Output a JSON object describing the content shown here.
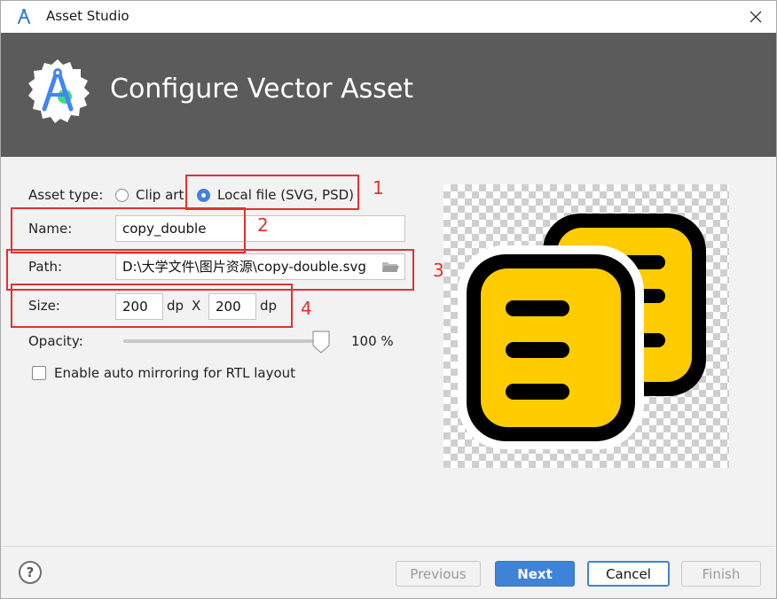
{
  "window": {
    "title": "Asset Studio"
  },
  "header": {
    "title": "Configure Vector Asset"
  },
  "form": {
    "asset_type_label": "Asset type:",
    "asset_type_options": [
      {
        "label": "Clip art",
        "selected": false
      },
      {
        "label": "Local file (SVG, PSD)",
        "selected": true
      }
    ],
    "name_label": "Name:",
    "name_value": "copy_double",
    "path_label": "Path:",
    "path_value": "D:\\大学文件\\图片资源\\copy-double.svg",
    "size_label": "Size:",
    "size_width": "200",
    "size_height": "200",
    "size_unit": "dp",
    "size_separator": "X",
    "opacity_label": "Opacity:",
    "opacity_value": "100 %",
    "opacity_level": 1.0,
    "rtl_label": "Enable auto mirroring for RTL layout",
    "rtl_checked": false
  },
  "annotations": [
    "1",
    "2",
    "3",
    "4"
  ],
  "footer": {
    "help": "?",
    "previous": "Previous",
    "next": "Next",
    "cancel": "Cancel",
    "finish": "Finish"
  },
  "colors": {
    "accent": "#3f83d6",
    "header_bg": "#5b5b5b",
    "annotation": "#e53030",
    "icon_fill": "#ffcc00"
  }
}
